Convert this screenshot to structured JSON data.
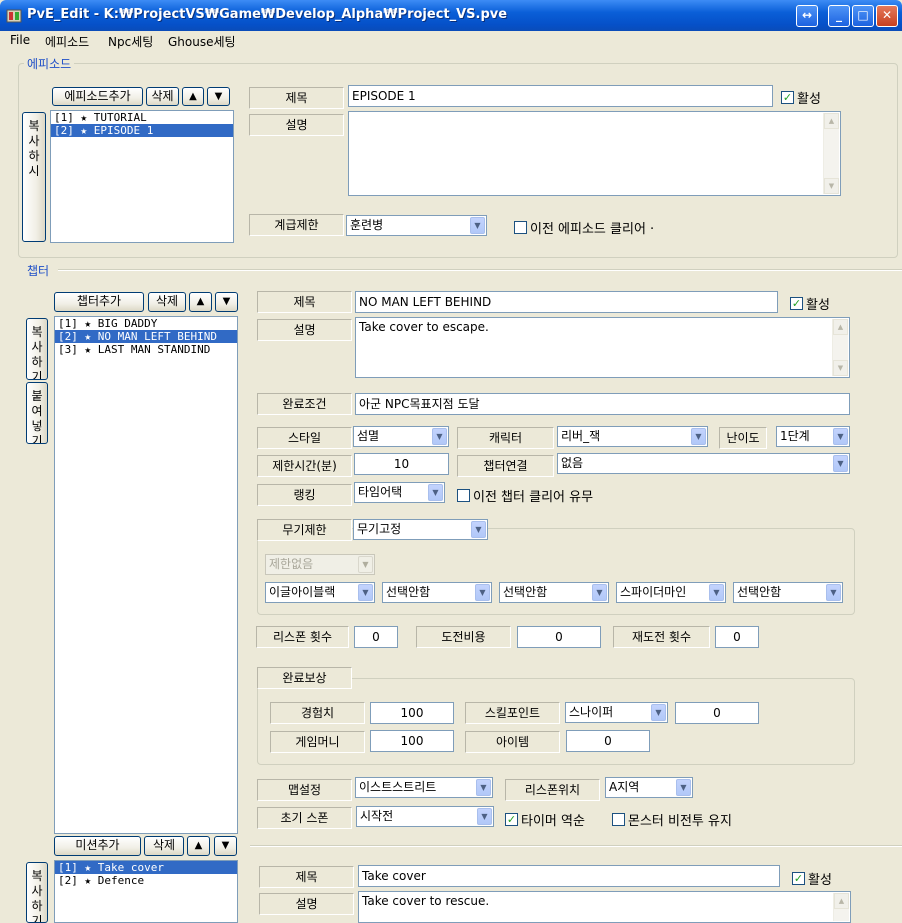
{
  "window": {
    "title": "PvE_Edit - K:₩ProjectVS₩Game₩Develop_Alpha₩Project_VS.pve",
    "restore_glyph": "↔",
    "min_glyph": "_",
    "max_glyph": "□",
    "close_glyph": "✕"
  },
  "menu": [
    "File",
    "에피소드",
    "Npc세팅",
    "Ghouse세팅"
  ],
  "episode": {
    "group_label": "에피소드",
    "add_label": "에피소드추가",
    "delete_label": "삭제",
    "up_glyph": "▲",
    "down_glyph": "▼",
    "copy_label": "복사하시",
    "list": [
      "[1] ★ TUTORIAL",
      "[2] ★ EPISODE 1"
    ],
    "selected_index": 1,
    "title_label": "제목",
    "title_value": "EPISODE 1",
    "active_label": "활성",
    "active_checked": true,
    "desc_label": "설명",
    "desc_value": "",
    "rank_label": "계급제한",
    "rank_value": "훈련병",
    "prev_clear_label": "이전 에피소드 클리어 ·",
    "prev_clear_checked": false
  },
  "chapter": {
    "group_label": "챕터",
    "add_label": "챕터추가",
    "delete_label": "삭제",
    "up_glyph": "▲",
    "down_glyph": "▼",
    "copy_label": "복사하기",
    "paste_label": "붙여넣기",
    "list": [
      "[1] ★ BIG DADDY",
      "[2] ★ NO MAN LEFT BEHIND",
      "[3] ★ LAST MAN STANDIND"
    ],
    "selected_index": 1,
    "title_label": "제목",
    "title_value": "NO MAN LEFT BEHIND",
    "active_label": "활성",
    "active_checked": true,
    "desc_label": "설명",
    "desc_value": "Take cover to escape.",
    "complete_cond_label": "완료조건",
    "complete_cond_value": "아군 NPC목표지점 도달",
    "style_label": "스타일",
    "style_value": "섬멸",
    "character_label": "캐릭터",
    "character_value": "리버_잭",
    "difficulty_label": "난이도",
    "difficulty_value": "1단계",
    "time_limit_label": "제한시간(분)",
    "time_limit_value": "10",
    "chapter_link_label": "챕터연결",
    "chapter_link_value": "없음",
    "ranking_label": "랭킹",
    "ranking_value": "타임어택",
    "prev_chapter_clear_label": "이전 챕터 클리어 유무",
    "prev_chapter_clear_checked": false,
    "weapon_limit_label": "무기제한",
    "weapon_limit_value": "무기고정",
    "weapon_limit_sub": "제한없음",
    "weapon_slots": [
      "이글아이블랙",
      "선택안함",
      "선택안함",
      "스파이더마인",
      "선택안함"
    ],
    "respawn_count_label": "리스폰 횟수",
    "respawn_count_value": "0",
    "challenge_cost_label": "도전비용",
    "challenge_cost_value": "0",
    "retry_count_label": "재도전 횟수",
    "retry_count_value": "0",
    "reward_label": "완료보상",
    "exp_label": "경험치",
    "exp_value": "100",
    "skill_point_label": "스킬포인트",
    "skill_point_class": "스나이퍼",
    "skill_point_value": "0",
    "game_money_label": "게임머니",
    "game_money_value": "100",
    "item_label": "아이템",
    "item_value": "0",
    "map_label": "맵설정",
    "map_value": "이스트스트리트",
    "respawn_pos_label": "리스폰위치",
    "respawn_pos_value": "A지역",
    "init_spawn_label": "초기 스폰",
    "init_spawn_value": "시작전",
    "timer_reverse_label": "타이머 역순",
    "timer_reverse_checked": true,
    "monster_nonbattle_label": "몬스터 비전투 유지",
    "monster_nonbattle_checked": false
  },
  "mission": {
    "add_label": "미션추가",
    "delete_label": "삭제",
    "up_glyph": "▲",
    "down_glyph": "▼",
    "copy_label": "복사하기",
    "list": [
      "[1] ★ Take cover",
      "[2] ★ Defence"
    ],
    "selected_index": 0,
    "title_label": "제목",
    "title_value": "Take cover",
    "active_label": "활성",
    "active_checked": true,
    "desc_label": "설명",
    "desc_value": "Take cover to rescue."
  },
  "colors": {
    "accent": "#316ac5",
    "group_legend": "#1f4fc7",
    "titlebar": "#0a5fd8",
    "face": "#ece9d8"
  },
  "icons": {
    "check": "✓",
    "dropdown": "▼",
    "scroll_up": "▲",
    "scroll_down": "▼"
  }
}
